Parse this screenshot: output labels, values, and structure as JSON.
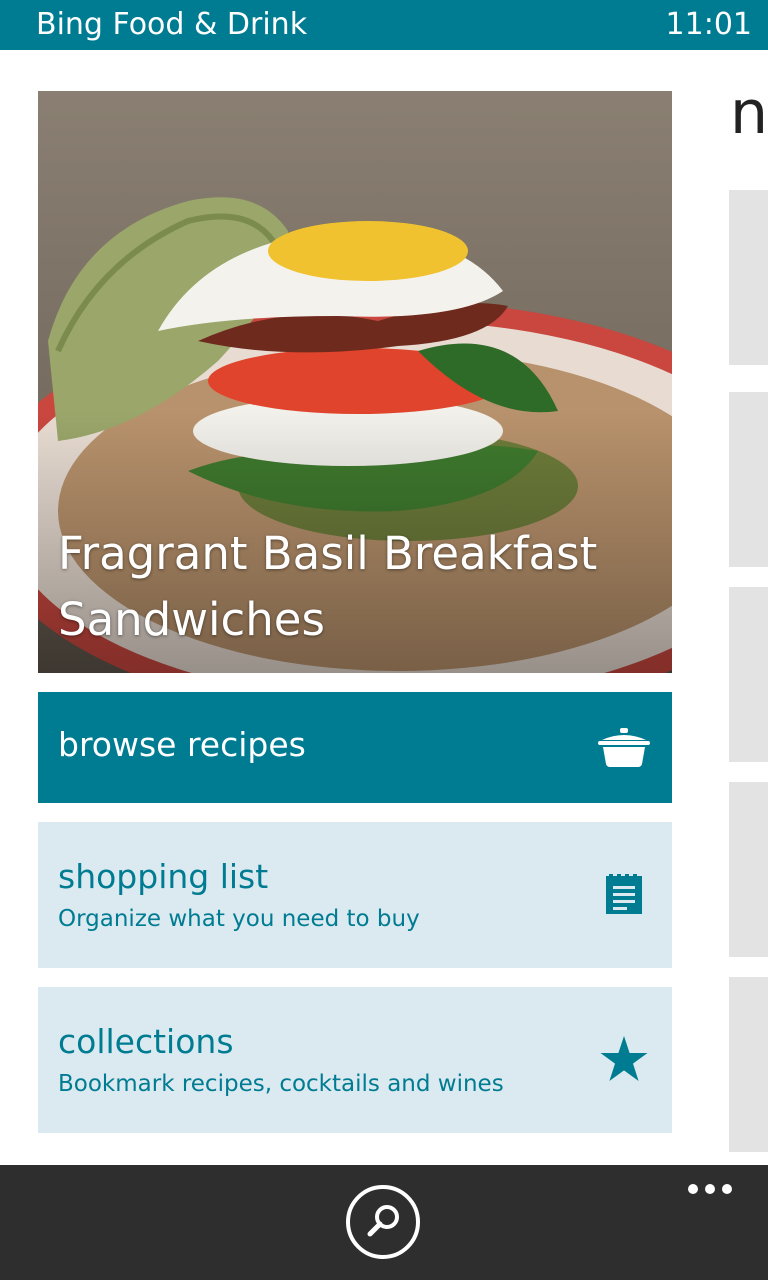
{
  "status_bar": {
    "app_title": "Bing Food & Drink",
    "clock": "11:01"
  },
  "hero": {
    "title": "Fragrant Basil Breakfast Sandwiches"
  },
  "tiles": {
    "browse": {
      "label": "browse recipes",
      "icon": "cooking-pot-icon"
    },
    "shopping": {
      "label": "shopping list",
      "subtitle": "Organize what you need to buy",
      "icon": "notepad-icon"
    },
    "collections": {
      "label": "collections",
      "subtitle": "Bookmark recipes, cocktails and wines",
      "icon": "star-icon"
    }
  },
  "next_panel": {
    "heading": "n"
  },
  "app_bar": {
    "search_icon": "search-icon",
    "more_icon": "ellipsis-icon"
  },
  "colors": {
    "accent": "#007c92",
    "tile_light": "#dbe9f0",
    "app_bar": "#2e2e2e"
  }
}
